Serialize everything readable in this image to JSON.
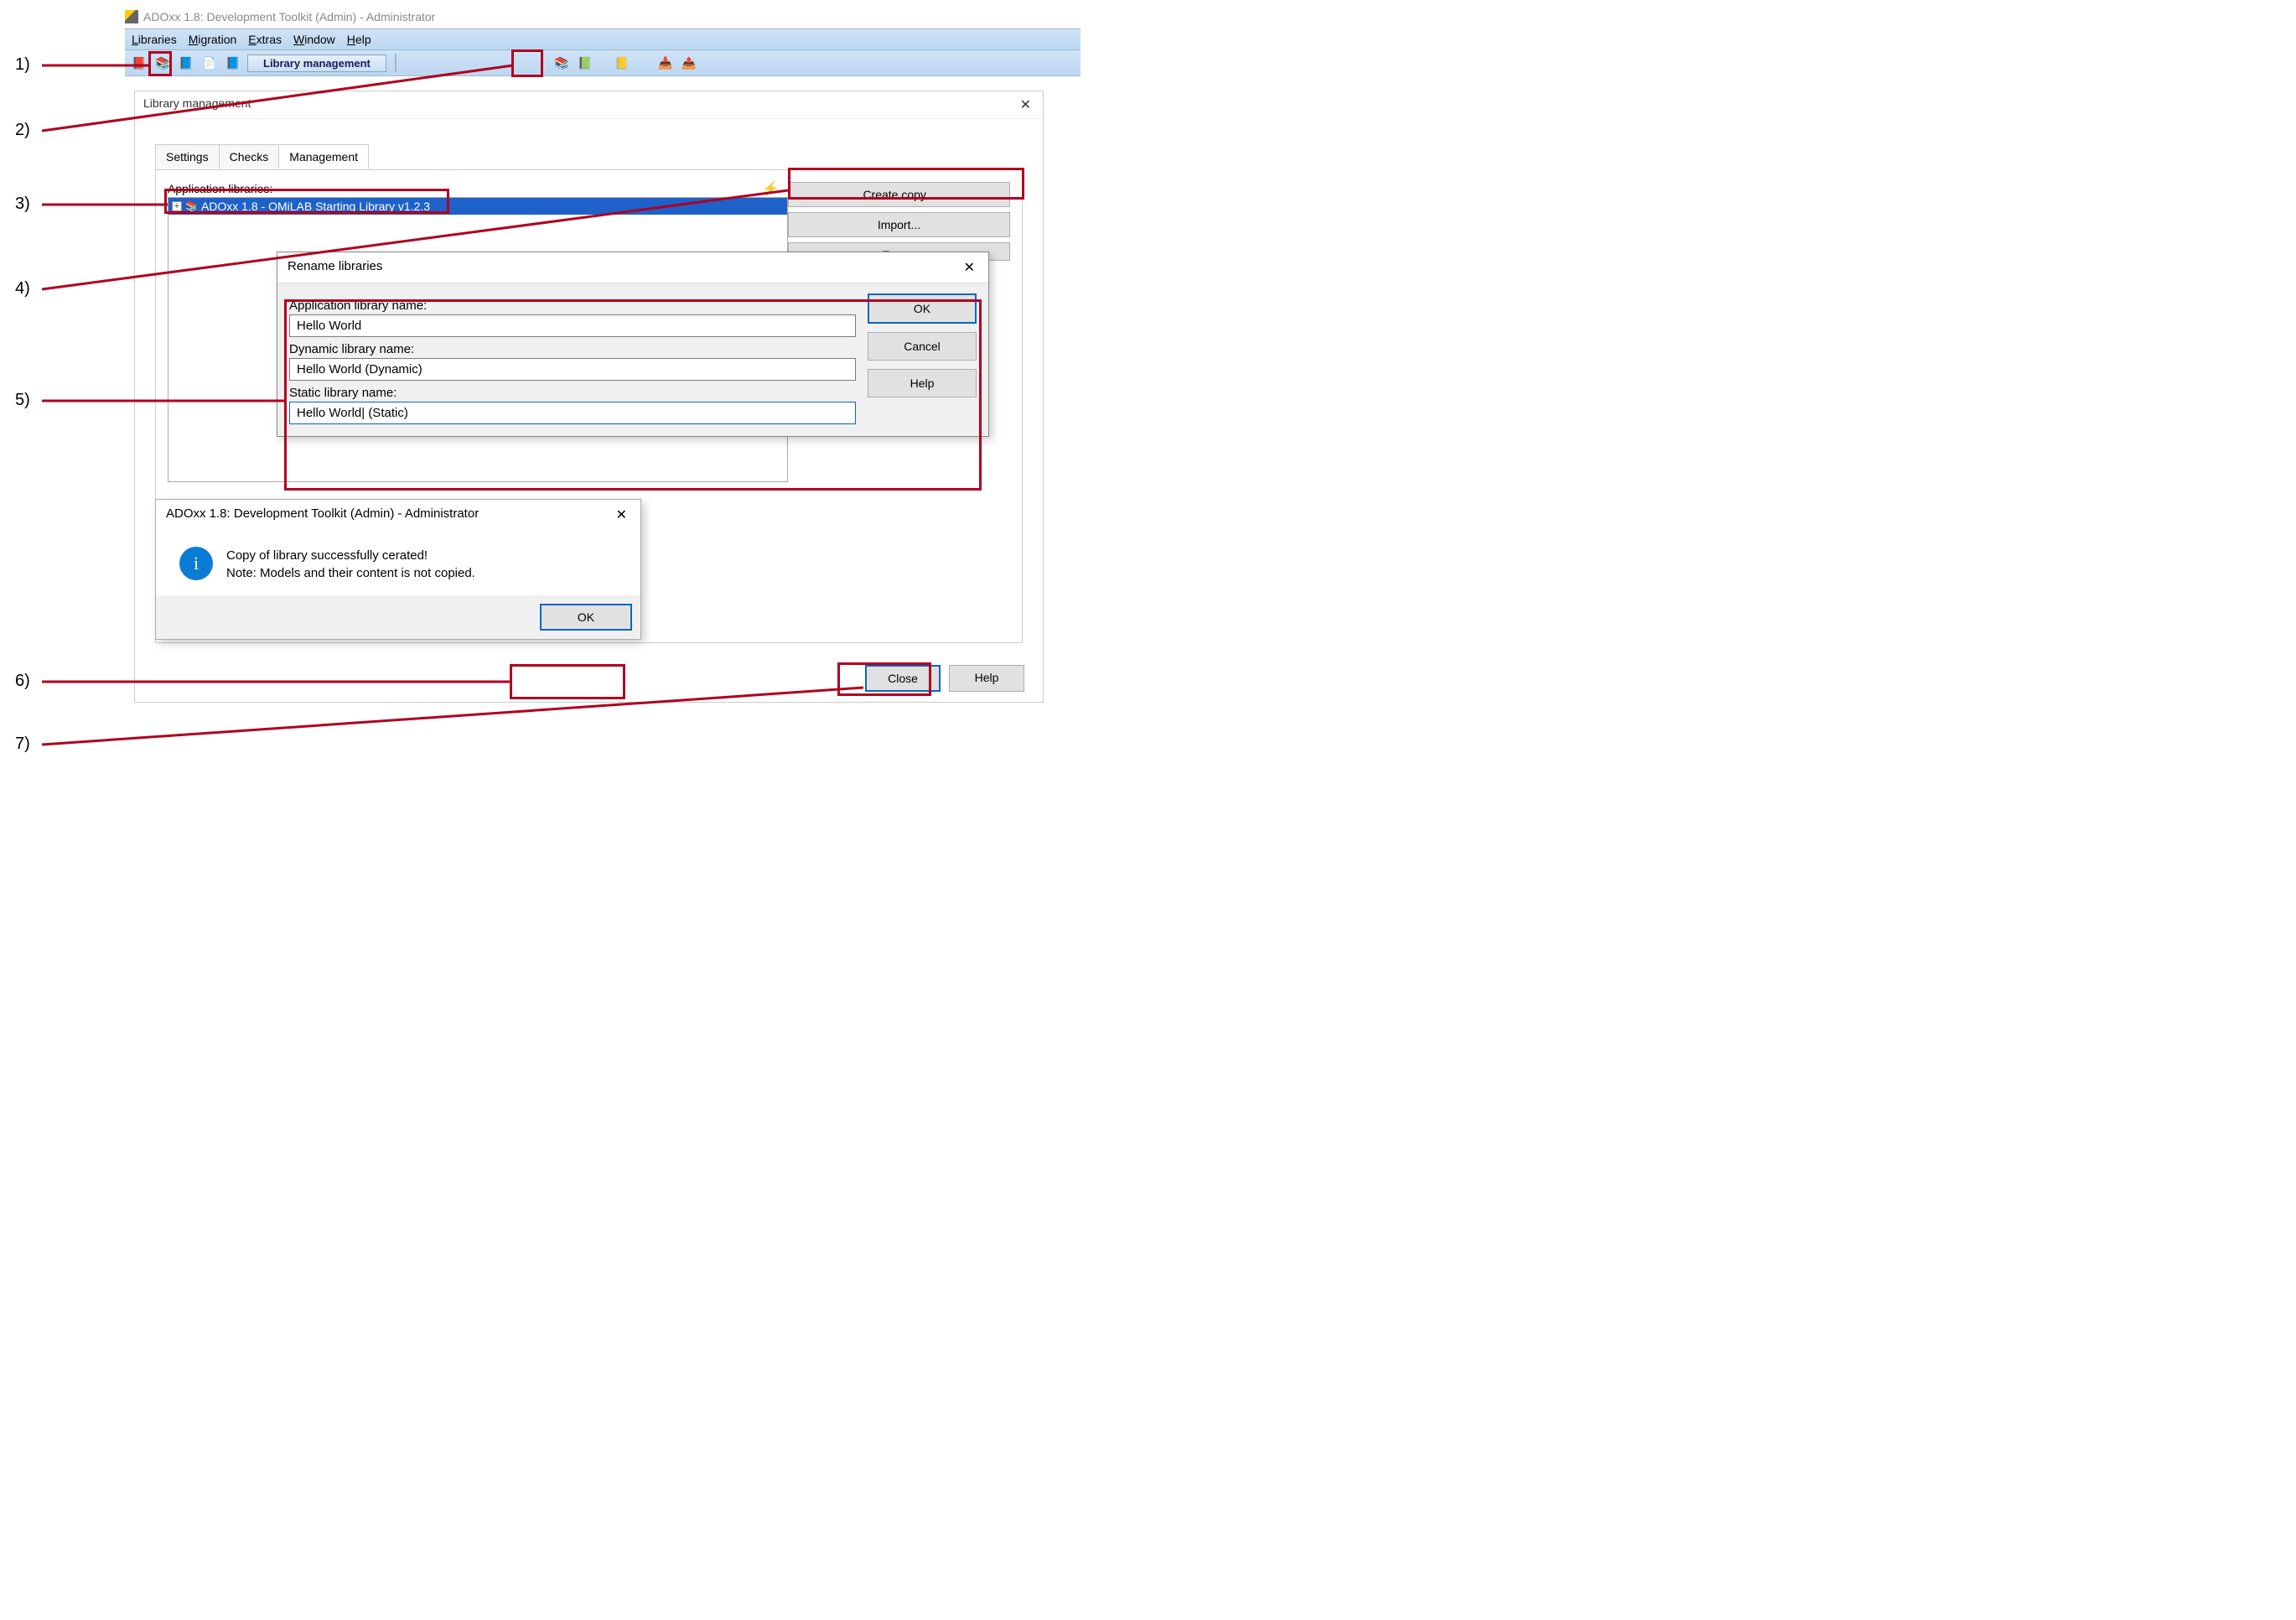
{
  "callouts": {
    "c1": "1)",
    "c2": "2)",
    "c3": "3)",
    "c4": "4)",
    "c5": "5)",
    "c6": "6)",
    "c7": "7)"
  },
  "window": {
    "title": "ADOxx 1.8: Development Toolkit (Admin) - Administrator"
  },
  "menu": {
    "libraries": "Libraries",
    "migration": "Migration",
    "extras": "Extras",
    "windowm": "Window",
    "help": "Help"
  },
  "toolbar": {
    "label": "Library management"
  },
  "libpanel": {
    "title": "Library management",
    "tabs": {
      "settings": "Settings",
      "checks": "Checks",
      "management": "Management"
    },
    "app_lib_label": "Application libraries:",
    "tree_item": "ADOxx 1.8 - OMiLAB Starting Library v1.2.3",
    "buttons": {
      "create_copy": "Create copy...",
      "import": "Import...",
      "export": "Export"
    },
    "close": "Close",
    "help": "Help"
  },
  "rename": {
    "title": "Rename libraries",
    "app_label": "Application library name:",
    "app_value": "Hello World",
    "dyn_label": "Dynamic library name:",
    "dyn_value": "Hello World (Dynamic)",
    "stat_label": "Static library name:",
    "stat_value": "Hello World| (Static)",
    "ok": "OK",
    "cancel": "Cancel",
    "help": "Help"
  },
  "msgbox": {
    "title": "ADOxx 1.8: Development Toolkit (Admin) - Administrator",
    "line1": "Copy of library successfully cerated!",
    "line2": "Note: Models and their content is not copied.",
    "ok": "OK"
  }
}
